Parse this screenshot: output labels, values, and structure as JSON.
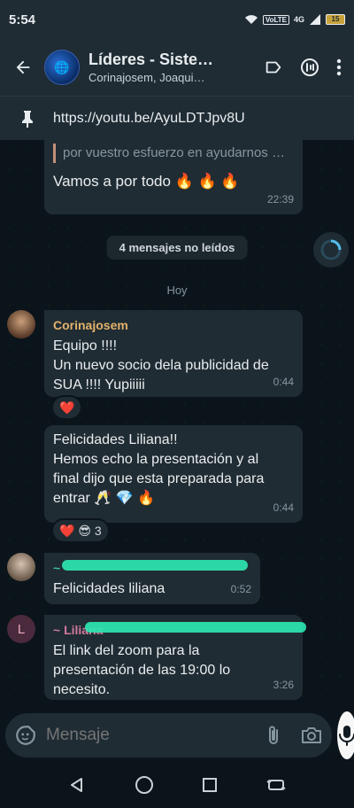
{
  "status_bar": {
    "time": "5:54",
    "network": "4G",
    "volte": "VoLTE",
    "battery": "15"
  },
  "header": {
    "title": "Líderes - Siste…",
    "subtitle": "Corinajosem, Joaqui…",
    "avatar_text": "🌐"
  },
  "pinned": {
    "text": "https://youtu.be/AyuLDTJpv8U"
  },
  "messages": {
    "m1": {
      "quote": "por vuestro esfuerzo en ayudarnos …",
      "text": "Vamos a por todo 🔥 🔥 🔥",
      "time": "22:39"
    },
    "unread": "4 mensajes no leídos",
    "day": "Hoy",
    "m2": {
      "sender": "Corinajosem",
      "line1": "Equipo !!!!",
      "line2": "Un nuevo socio dela publicidad de",
      "line3": "SUA !!!! Yupiiiii",
      "time": "0:44",
      "reaction": "❤️"
    },
    "m3": {
      "line1": "Felicidades Liliana!!",
      "line2": "Hemos echo la presentación y al",
      "line3": "final dijo que esta preparada para",
      "line4": "entrar 🥂 💎 🔥",
      "time": "0:44",
      "reaction_emojis": "❤️ 😎",
      "reaction_count": "3"
    },
    "m4": {
      "sender_prefix": "~",
      "text": "Felicidades liliana",
      "time": "0:52"
    },
    "m5": {
      "sender": "~ Liliana",
      "avatar_letter": "L",
      "line1": "El link del zoom para la",
      "line2": "presentación de las 19:00 lo",
      "line3": "necesito.",
      "time": "3:26"
    }
  },
  "input": {
    "placeholder": "Mensaje"
  },
  "colors": {
    "accent": "#e3b26b",
    "bubble": "#202c33",
    "background": "#0b141a",
    "header": "#1f2c34",
    "redaction": "#2ee6b0"
  },
  "icons": {
    "back": "arrow-left-icon",
    "label": "label-icon",
    "call": "call-add-icon",
    "menu": "more-vert-icon",
    "pin": "pin-icon",
    "emoji": "sticker-icon",
    "attach": "paperclip-icon",
    "camera": "camera-icon",
    "mic": "mic-icon",
    "scroll": "scroll-down-icon"
  }
}
